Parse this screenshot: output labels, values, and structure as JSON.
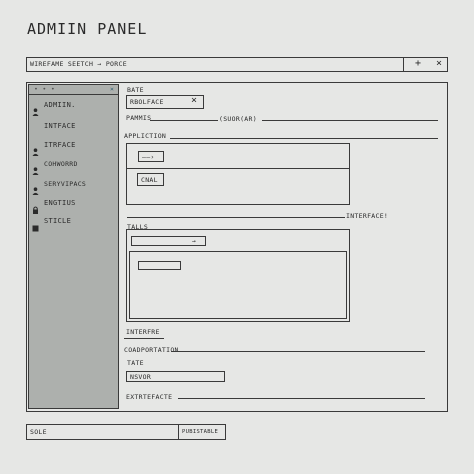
{
  "window": {
    "title": "ADMIIN PANEL",
    "toolbar_text": "WIREFAME  SEETCH  →  PORCE",
    "plus_label": "+",
    "close_label": "×"
  },
  "sidebar": {
    "header": "•  •  •",
    "close_label": "×",
    "items": [
      {
        "label": "ADMIIN.",
        "icon": "user-icon"
      },
      {
        "label": "INTFACE",
        "icon": ""
      },
      {
        "label": "ITRFACE",
        "icon": "user-icon"
      },
      {
        "label": "COHWORRD",
        "icon": "user-icon"
      },
      {
        "label": "SERYVIPACS",
        "icon": "user-icon"
      },
      {
        "label": "ENGTIUS",
        "icon": "lock-icon"
      },
      {
        "label": "STICLE",
        "icon": "square-icon"
      }
    ]
  },
  "main": {
    "bate_label": "BATE",
    "chip": {
      "label": "RBOLFACE",
      "close": "×"
    },
    "pammis_label": "PAMMIS",
    "suor_label": "(SUOR(AR)",
    "application_label": "APPLICTION",
    "app_dropdown_text": "——›",
    "app_button_label": "CNAL",
    "interface_label": "INTERFACE!",
    "talls_label": "TALLS",
    "talls_input_arrow": "→",
    "interfre_label": "INTERFRE",
    "coadportation_label": "COADPORTATION",
    "tate_label": "TATE",
    "nsvor_value": "NSVOR",
    "extrefacte_label": "EXTRTEFACTE"
  },
  "footer": {
    "sole_label": "SOLE",
    "publish_label": "PUBISTABLE"
  }
}
